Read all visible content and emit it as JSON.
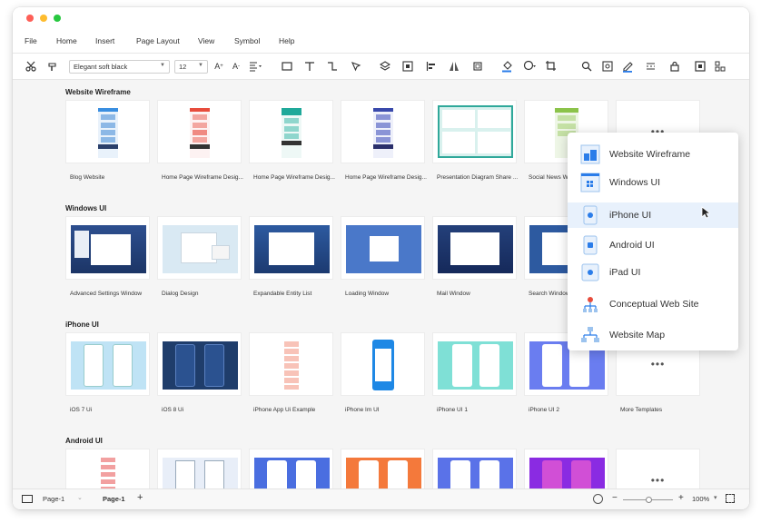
{
  "menu": [
    "File",
    "Home",
    "Insert",
    "Page Layout",
    "View",
    "Symbol",
    "Help"
  ],
  "toolbar": {
    "font_name": "Elegant soft black",
    "font_size": "12"
  },
  "sections": [
    {
      "title": "Website Wireframe",
      "cards": [
        "Blog Website",
        "Home Page Wireframe Desig...",
        "Home Page Wireframe Desig...",
        "Home Page Wireframe Desig...",
        "Presentation Diagram Share ...",
        "Social News W..."
      ]
    },
    {
      "title": "Windows UI",
      "cards": [
        "Advanced Settings Window",
        "Dialog Design",
        "Expandable Entity List",
        "Loading Window",
        "Mail Window",
        "Search Window"
      ]
    },
    {
      "title": "iPhone UI",
      "cards": [
        "iOS 7 Ui",
        "iOS 8 Ui",
        "iPhone App Ui Example",
        "iPhone Im UI",
        "iPhone UI 1",
        "iPhone UI 2",
        "More Templates"
      ]
    },
    {
      "title": "Android UI",
      "cards": []
    }
  ],
  "more_dots": "•••",
  "dropdown": {
    "items": [
      "Website Wireframe",
      "Windows UI",
      "iPhone UI",
      "Android UI",
      "iPad UI",
      "Conceptual Web Site",
      "Website Map"
    ],
    "active": "iPhone UI"
  },
  "statusbar": {
    "page_selector": "Page-1",
    "page_tab": "Page-1",
    "add": "+",
    "zoom_minus": "−",
    "zoom_plus": "+",
    "zoom": "100%",
    "zoom_level": 0.5
  },
  "colors": {
    "accent": "#2b7de9",
    "dot_red": "#fe5f57",
    "dot_yellow": "#febc2e",
    "dot_green": "#28c840",
    "active_bg": "#e8f1fc"
  }
}
